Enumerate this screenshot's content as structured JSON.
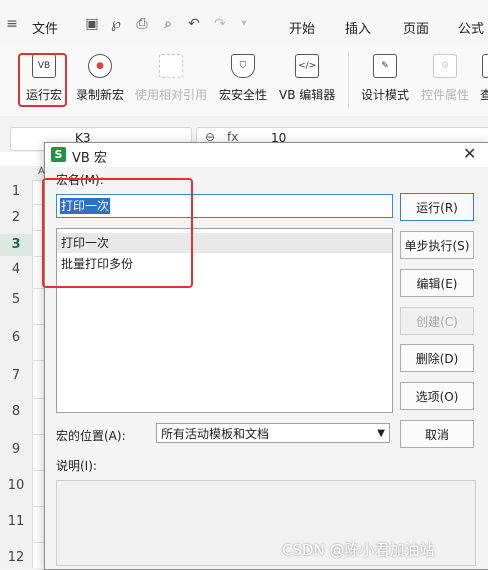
{
  "menubar": {
    "file": "文件",
    "tabs": [
      "开始",
      "插入",
      "页面",
      "公式"
    ]
  },
  "ribbon": {
    "run_macro": "运行宏",
    "record_macro": "录制新宏",
    "relative_ref": "使用相对引用",
    "macro_security": "宏安全性",
    "vb_editor": "VB 编辑器",
    "design_mode": "设计模式",
    "control_props": "控件属性",
    "more": "查",
    "vb_icon": "VB"
  },
  "formulabar": {
    "cell_ref": "K3",
    "value": "10"
  },
  "sheet": {
    "col_a": "A",
    "rows": [
      "1",
      "2",
      "3",
      "4",
      "5",
      "6",
      "7",
      "8",
      "9",
      "10",
      "11",
      "12"
    ],
    "active_row": "3"
  },
  "dialog": {
    "app_icon": "S",
    "title": "VB 宏",
    "name_label": "宏名(M):",
    "name_value": "打印一次",
    "macros": [
      "打印一次",
      "批量打印多份"
    ],
    "buttons": {
      "run": "运行(R)",
      "step": "单步执行(S)",
      "edit": "编辑(E)",
      "create": "创建(C)",
      "delete": "删除(D)",
      "options": "选项(O)",
      "cancel": "取消"
    },
    "location_label": "宏的位置(A):",
    "location_value": "所有活动模板和文档",
    "description_label": "说明(I):"
  },
  "watermark": "CSDN @陈小君加油站",
  "colors": {
    "accent": "#2f6fc7",
    "annotation": "#e0332f",
    "app_green": "#1e9447"
  }
}
